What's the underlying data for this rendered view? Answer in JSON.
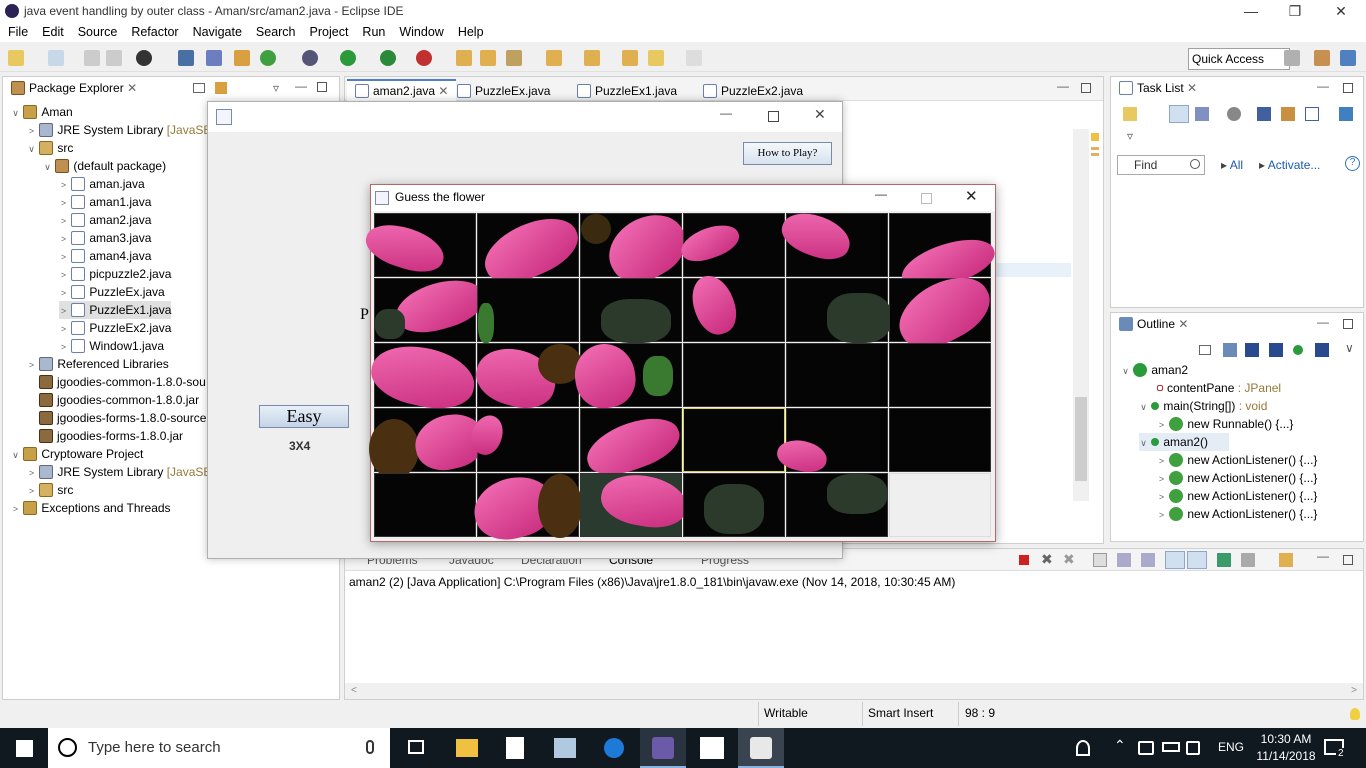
{
  "window": {
    "title": "java event handling by outer class - Aman/src/aman2.java - Eclipse IDE"
  },
  "menu": [
    "File",
    "Edit",
    "Source",
    "Refactor",
    "Navigate",
    "Search",
    "Project",
    "Run",
    "Window",
    "Help"
  ],
  "quick_access": "Quick Access",
  "package_explorer": {
    "title": "Package Explorer",
    "items": [
      {
        "label": "Aman",
        "icon": "project-icon"
      },
      {
        "label": "JRE System Library",
        "suffix": "[JavaSE-1",
        "icon": "library-icon"
      },
      {
        "label": "src",
        "icon": "source-folder-icon"
      },
      {
        "label": "(default package)",
        "icon": "package-icon"
      },
      {
        "label": "aman.java",
        "icon": "java-file-icon"
      },
      {
        "label": "aman1.java",
        "icon": "java-file-icon"
      },
      {
        "label": "aman2.java",
        "icon": "java-file-icon"
      },
      {
        "label": "aman3.java",
        "icon": "java-file-icon"
      },
      {
        "label": "aman4.java",
        "icon": "java-file-icon"
      },
      {
        "label": "picpuzzle2.java",
        "icon": "java-file-icon"
      },
      {
        "label": "PuzzleEx.java",
        "icon": "java-file-icon"
      },
      {
        "label": "PuzzleEx1.java",
        "icon": "java-file-icon"
      },
      {
        "label": "PuzzleEx2.java",
        "icon": "java-file-icon"
      },
      {
        "label": "Window1.java",
        "icon": "java-file-icon"
      },
      {
        "label": "Referenced Libraries",
        "icon": "library-icon"
      },
      {
        "label": "jgoodies-common-1.8.0-sou",
        "icon": "jar-icon"
      },
      {
        "label": "jgoodies-common-1.8.0.jar",
        "icon": "jar-icon"
      },
      {
        "label": "jgoodies-forms-1.8.0-source",
        "icon": "jar-icon"
      },
      {
        "label": "jgoodies-forms-1.8.0.jar",
        "icon": "jar-icon"
      },
      {
        "label": "Cryptoware Project",
        "icon": "project-icon"
      },
      {
        "label": "JRE System Library",
        "suffix": "[JavaSE-1",
        "icon": "library-icon"
      },
      {
        "label": "src",
        "icon": "source-folder-icon"
      },
      {
        "label": "Exceptions and Threads",
        "icon": "project-icon"
      }
    ]
  },
  "editor_tabs": [
    "aman2.java",
    "PuzzleEx.java",
    "PuzzleEx1.java",
    "PuzzleEx2.java"
  ],
  "task_list": {
    "title": "Task List",
    "find_placeholder": "Find",
    "all": "All",
    "activate": "Activate..."
  },
  "outline": {
    "title": "Outline",
    "items": [
      {
        "label": "aman2"
      },
      {
        "label": "contentPane",
        "type": " : JPanel"
      },
      {
        "label": "main(String[])",
        "type": " : void"
      },
      {
        "label": "new Runnable() {...}"
      },
      {
        "label": "aman2()"
      },
      {
        "label": "new ActionListener() {...}"
      },
      {
        "label": "new ActionListener() {...}"
      },
      {
        "label": "new ActionListener() {...}"
      },
      {
        "label": "new ActionListener() {...}"
      }
    ]
  },
  "console": {
    "tabs": [
      "Problems",
      "Javadoc",
      "Declaration",
      "Console",
      "Progress"
    ],
    "line": "aman2 (2) [Java Application] C:\\Program Files (x86)\\Java\\jre1.8.0_181\\bin\\javaw.exe (Nov 14, 2018, 10:30:45 AM)"
  },
  "status": {
    "writable": "Writable",
    "insert": "Smart Insert",
    "position": "98 : 9"
  },
  "app_window": {
    "how_to_play": "How to Play?",
    "easy": "Easy",
    "grid": "3X4",
    "partial_letter": "P"
  },
  "puzzle_window": {
    "title": "Guess the flower"
  },
  "taskbar": {
    "search_placeholder": "Type here to search",
    "lang": "ENG",
    "time": "10:30 AM",
    "date": "11/14/2018",
    "notifications": "2"
  }
}
